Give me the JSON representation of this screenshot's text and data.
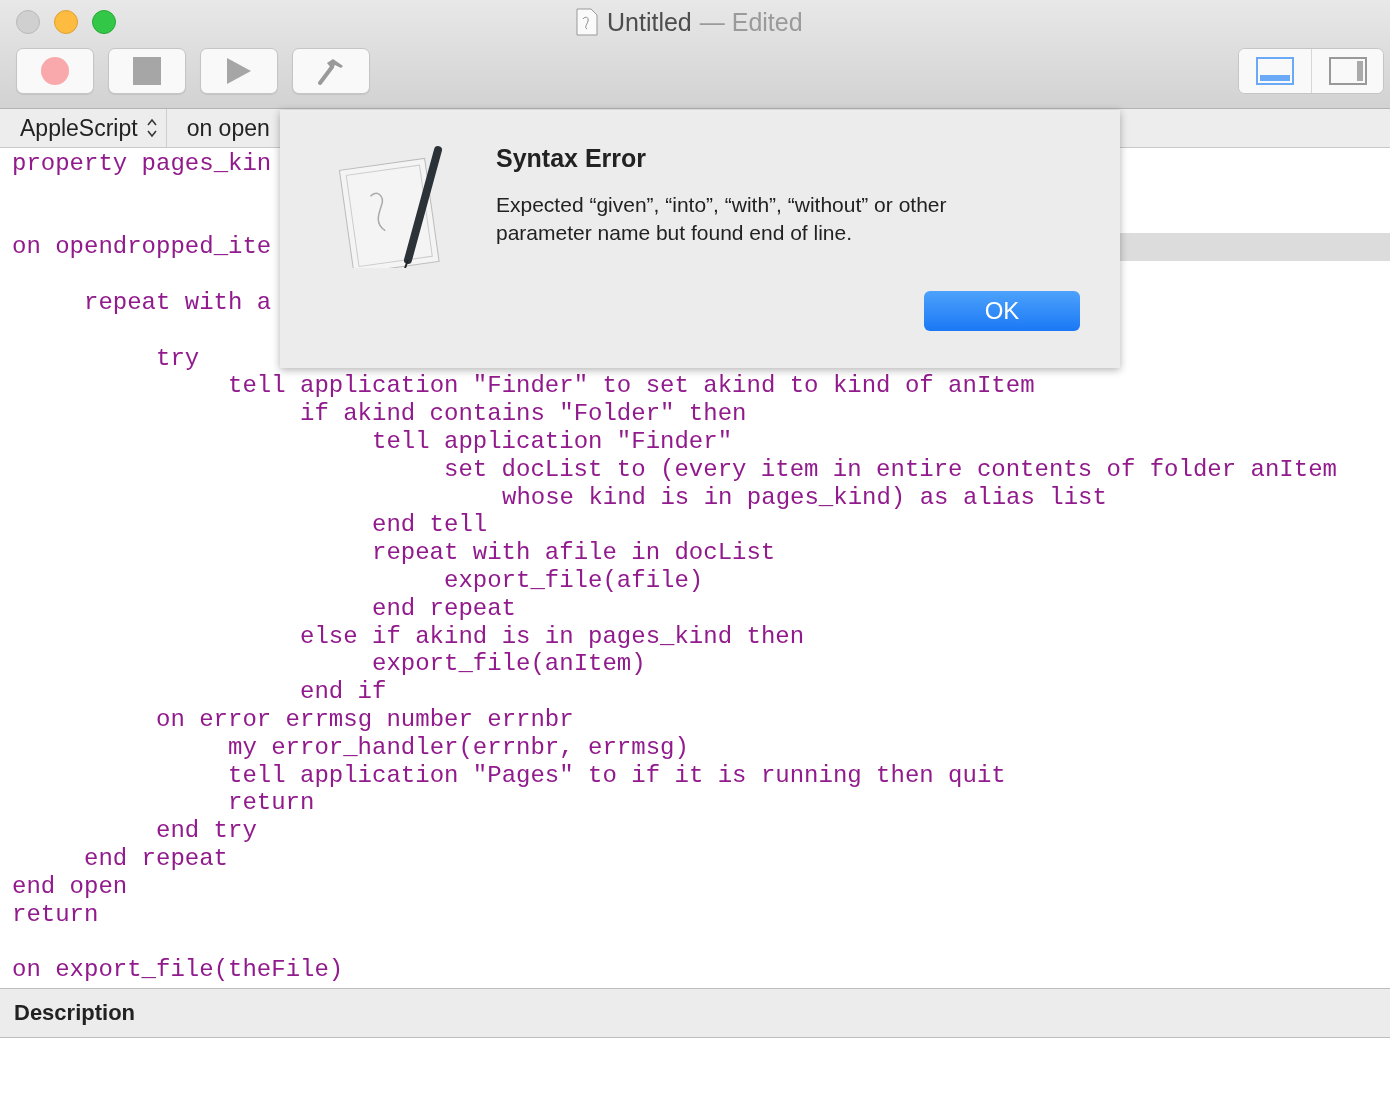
{
  "window": {
    "title": "Untitled",
    "subtitle": "— Edited"
  },
  "toolbar": {
    "buttons": [
      {
        "kind": "record"
      },
      {
        "kind": "stop"
      },
      {
        "kind": "run"
      },
      {
        "kind": "compile"
      }
    ],
    "view_buttons": [
      {
        "kind": "bottom-pane",
        "selected": true
      },
      {
        "kind": "side-pane",
        "selected": false
      }
    ]
  },
  "navigation_bar": {
    "language": "AppleScript",
    "handler": "on open"
  },
  "editor": {
    "lines": [
      {
        "kind": "code",
        "text": "property pages_kin",
        "highlighted": false
      },
      {
        "kind": "blank"
      },
      {
        "kind": "blank"
      },
      {
        "kind": "code",
        "text": "on opendropped_ite",
        "highlighted": true,
        "children": [
          {
            "kind": "blank"
          },
          {
            "kind": "code",
            "text": "repeat with a",
            "highlighted": false,
            "children": [
              {
                "kind": "blank"
              },
              {
                "kind": "code",
                "text": "try",
                "highlighted": false,
                "children": [
                  {
                    "kind": "code",
                    "text": "tell application \"Finder\" to set akind to kind of anItem",
                    "highlighted": false,
                    "children": [
                      {
                        "kind": "code",
                        "text": "if akind contains \"Folder\" then",
                        "highlighted": false,
                        "children": [
                          {
                            "kind": "code",
                            "text": "tell application \"Finder\"",
                            "highlighted": false,
                            "children": [
                              {
                                "kind": "code",
                                "text": "set docList to (every item in entire contents of folder anItem whose kind is in pages_kind) as alias list",
                                "highlighted": false
                              }
                            ]
                          },
                          {
                            "kind": "code",
                            "text": "end tell",
                            "highlighted": false
                          },
                          {
                            "kind": "code",
                            "text": "repeat with afile in docList",
                            "highlighted": false,
                            "children": [
                              {
                                "kind": "code",
                                "text": "export_file(afile)",
                                "highlighted": false
                              }
                            ]
                          },
                          {
                            "kind": "code",
                            "text": "end repeat",
                            "highlighted": false
                          }
                        ]
                      },
                      {
                        "kind": "code",
                        "text": "else if akind is in pages_kind then",
                        "highlighted": false,
                        "children": [
                          {
                            "kind": "code",
                            "text": "export_file(anItem)",
                            "highlighted": false
                          }
                        ]
                      },
                      {
                        "kind": "code",
                        "text": "end if",
                        "highlighted": false
                      }
                    ]
                  }
                ]
              },
              {
                "kind": "code",
                "text": "on error errmsg number errnbr",
                "highlighted": false,
                "children": [
                  {
                    "kind": "code",
                    "text": "my error_handler(errnbr, errmsg)",
                    "highlighted": false
                  },
                  {
                    "kind": "code",
                    "text": "tell application \"Pages\" to if it is running then quit",
                    "highlighted": false
                  },
                  {
                    "kind": "code",
                    "text": "return",
                    "highlighted": false
                  }
                ]
              },
              {
                "kind": "code",
                "text": "end try",
                "highlighted": false
              }
            ]
          },
          {
            "kind": "code",
            "text": "end repeat",
            "highlighted": false
          }
        ]
      },
      {
        "kind": "code",
        "text": "end open",
        "highlighted": false
      },
      {
        "kind": "code",
        "text": "return",
        "highlighted": false
      },
      {
        "kind": "blank"
      },
      {
        "kind": "code",
        "text": "on export_file(theFile)",
        "highlighted": false
      }
    ]
  },
  "description_pane": {
    "title": "Description"
  },
  "alert": {
    "title": "Syntax Error",
    "message": "Expected “given”, “into”, “with”, “without” or other parameter name but found end of line.",
    "button": "OK"
  }
}
